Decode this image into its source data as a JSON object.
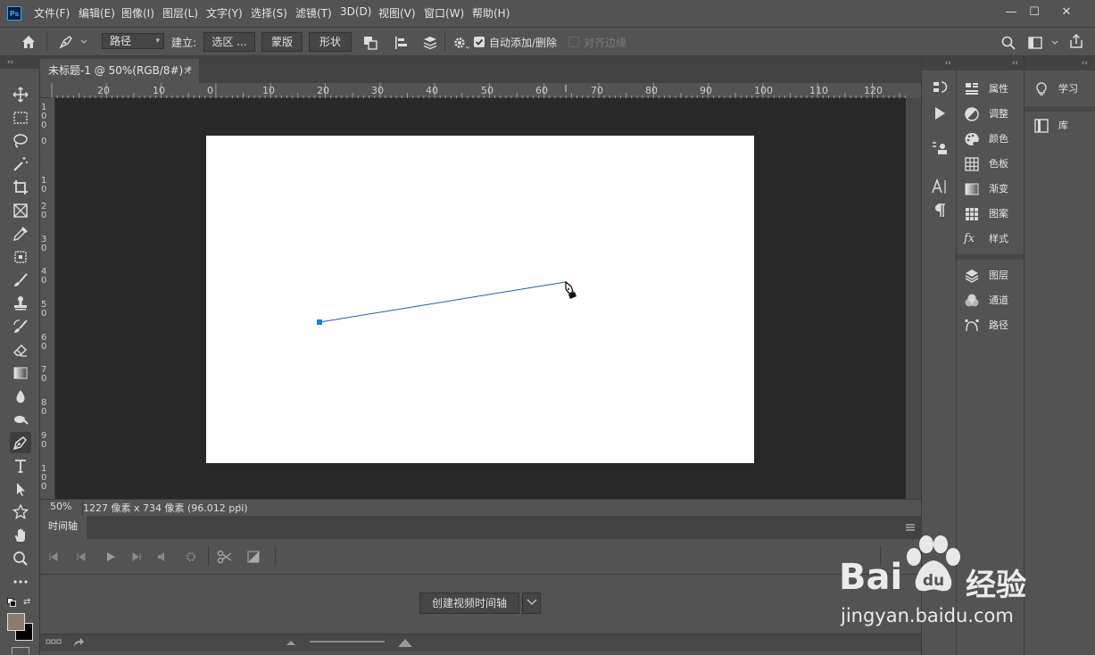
{
  "app": {
    "logo": "Ps"
  },
  "menu": [
    "文件(F)",
    "编辑(E)",
    "图像(I)",
    "图层(L)",
    "文字(Y)",
    "选择(S)",
    "滤镜(T)",
    "3D(D)",
    "视图(V)",
    "窗口(W)",
    "帮助(H)"
  ],
  "window_controls": {
    "minimize": "—",
    "maximize": "☐",
    "close": "✕"
  },
  "options": {
    "mode_value": "路径",
    "build_label": "建立:",
    "selection_btn": "选区 ...",
    "mask_btn": "蒙版",
    "shape_btn": "形状",
    "auto_add_label": "自动添加/删除",
    "auto_add_checked": true,
    "align_edges_label": "对齐边缘"
  },
  "document": {
    "tab_title": "未标题-1 @ 50%(RGB/8#) *",
    "tab_close": "×",
    "zoom": "50%",
    "info": "1227 像素 x 734 像素 (96.012 ppi)",
    "ruler_top_labels": [
      "20",
      "10",
      "0",
      "10",
      "20",
      "30",
      "40",
      "50",
      "60",
      "70",
      "80",
      "90",
      "100",
      "110",
      "120"
    ],
    "ruler_left_labels": [
      "1\n0\n0",
      "0",
      "1\n0",
      "2\n0",
      "3\n0",
      "4\n0",
      "5\n0",
      "6\n0",
      "7\n0",
      "8\n0",
      "9\n0",
      "1\n0\n0"
    ]
  },
  "timeline": {
    "tab_label": "时间轴",
    "create_btn": "创建视频时间轴"
  },
  "panels": {
    "group1": [
      "属性",
      "调整",
      "颜色",
      "色板",
      "渐变",
      "图案",
      "样式"
    ],
    "group2": [
      "图层",
      "通道",
      "路径"
    ],
    "learn": "学习",
    "library": "库"
  },
  "collapse_glyph": "‹‹",
  "expand_glyph": "››",
  "watermark": {
    "brand_a": "Bai",
    "brand_b": "经验",
    "url": "jingyan.baidu.com"
  },
  "colors": {
    "accent": "#1473e6",
    "path_line": "#1a5fb4",
    "anchor": "#1c7fe0",
    "foreground": "#8b7b6f",
    "background": "#000000"
  }
}
